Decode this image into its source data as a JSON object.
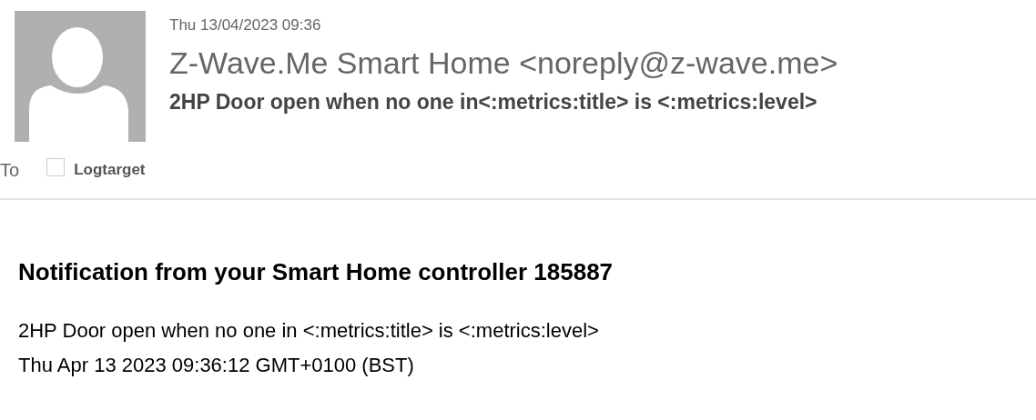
{
  "header": {
    "date": "Thu 13/04/2023 09:36",
    "sender": "Z-Wave.Me Smart Home <noreply@z-wave.me>",
    "subject": "2HP Door open when no one in<:metrics:title> is <:metrics:level>",
    "to_label": "To",
    "recipients": [
      "Logtarget"
    ]
  },
  "body": {
    "heading": "Notification from your Smart Home controller 185887",
    "lines": [
      "2HP Door open when no one in <:metrics:title> is <:metrics:level>",
      "Thu Apr 13 2023 09:36:12 GMT+0100 (BST)"
    ]
  }
}
